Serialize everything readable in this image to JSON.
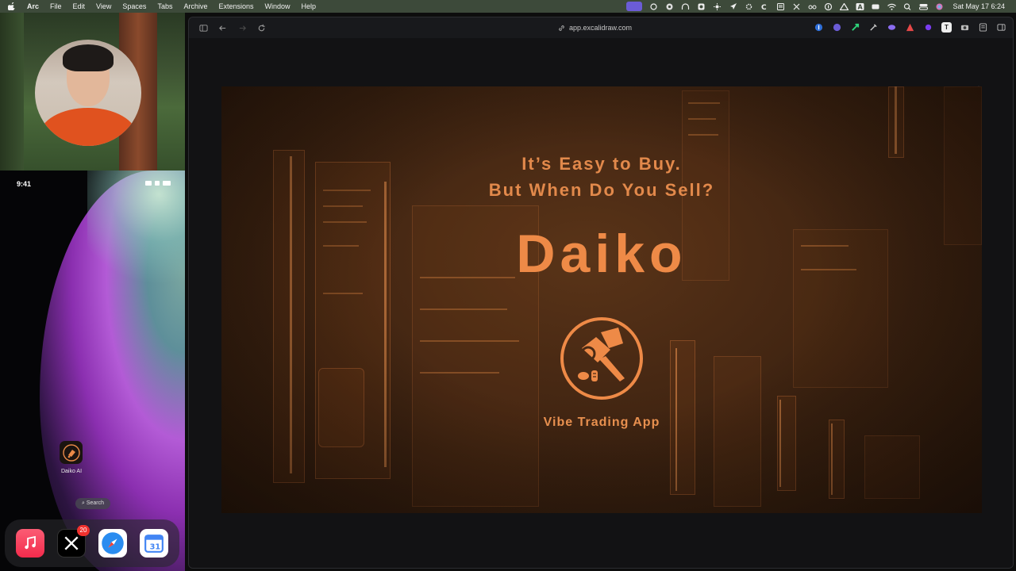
{
  "menubar": {
    "app_name": "Arc",
    "menus": [
      "File",
      "Edit",
      "View",
      "Spaces",
      "Tabs",
      "Archive",
      "Extensions",
      "Window",
      "Help"
    ],
    "clock": "Sat May 17  6:24"
  },
  "phone": {
    "time": "9:41",
    "app_label": "Daiko AI",
    "search_label": "Search",
    "dock_badge": "20"
  },
  "browser": {
    "url": "app.excalidraw.com"
  },
  "slide": {
    "tagline_line1": "It’s Easy to Buy.",
    "tagline_line2": "But When Do You Sell?",
    "brand": "Daiko",
    "subtitle": "Vibe Trading App"
  },
  "colors": {
    "accent": "#ee8a47",
    "slide_bg": "#3a2110",
    "menubar_bg": "#3d4a3a"
  }
}
